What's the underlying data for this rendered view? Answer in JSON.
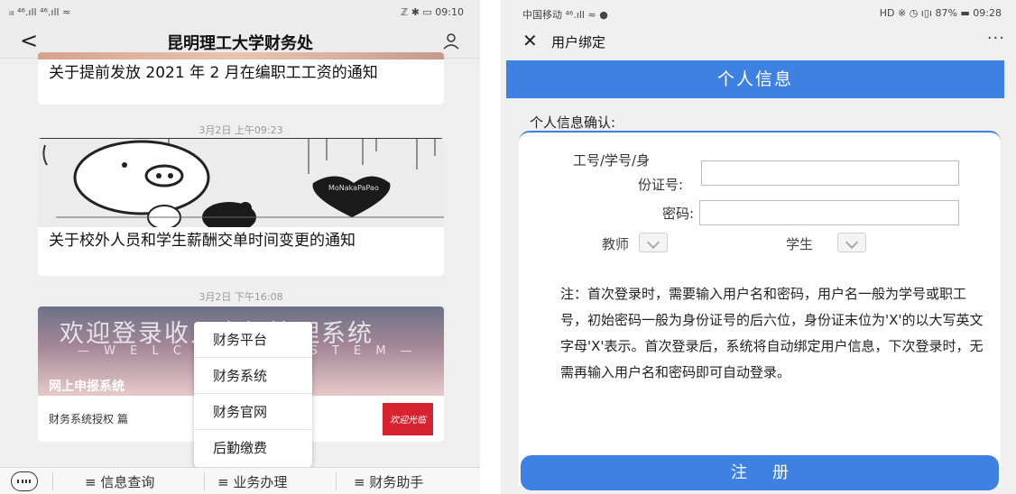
{
  "left_phone": {
    "status_bar": {
      "signal": "ᵢₗₗ ⁴⁶.ıll ⁴⁶.ıll ≈",
      "right": "ℤ ✱ ▭ 09:10"
    },
    "nav": {
      "back": "<",
      "title": "昆明理工大学财务处"
    },
    "articles": [
      {
        "title": "关于提前发放 2021 年 2 月在编职工工资的通知"
      },
      {
        "timestamp": "3月2日 上午09:23",
        "title": "关于校外人员和学生薪酬交单时间变更的通知",
        "image_text": "MoNakaPaPao"
      },
      {
        "timestamp": "3月2日 下午16:08",
        "image_welcome": "欢迎登录收入申报管理系统",
        "image_welcome_en": "— W E L C O M E   S Y S T E M —",
        "image_portal": "网上申报系统",
        "subtitle": "财务系统授权 篇",
        "thumb_text": "欢迎光临"
      }
    ],
    "popup_menu": [
      "财务平台",
      "财务系统",
      "财务官网",
      "后勤缴费"
    ],
    "bottom_tabs": [
      "≡ 信息查询",
      "≡ 业务办理",
      "≡ 财务助手"
    ]
  },
  "right_phone": {
    "status_bar": {
      "carrier": "中国移动 ⁴⁶.ıll ≈ ●",
      "right": "HD ※ ◷ ı▯ı 87% ▬ 09:28"
    },
    "nav": {
      "close": "✕",
      "title": "用户绑定",
      "more": "···"
    },
    "header": "个人信息",
    "section_label": "个人信息确认:",
    "form": {
      "id_label_line1": "工号/学号/身",
      "id_label_line2": "份证号:",
      "password_label": "密码:",
      "teacher_label": "教师",
      "student_label": "学生",
      "id_value": "",
      "password_value": ""
    },
    "note": "注：首次登录时，需要输入用户名和密码，用户名一般为学号或职工号，初始密码一般为身份证号的后六位，身份证末位为'X'的以大写英文字母'X'表示。首次登录后，系统将自动绑定用户信息，下次登录时，无需再输入用户名和密码即可自动登录。",
    "register_button": "注册"
  },
  "colors": {
    "accent_blue": "#3d82e3",
    "left_background": "#efefef",
    "thumb_red": "#d6232f"
  }
}
